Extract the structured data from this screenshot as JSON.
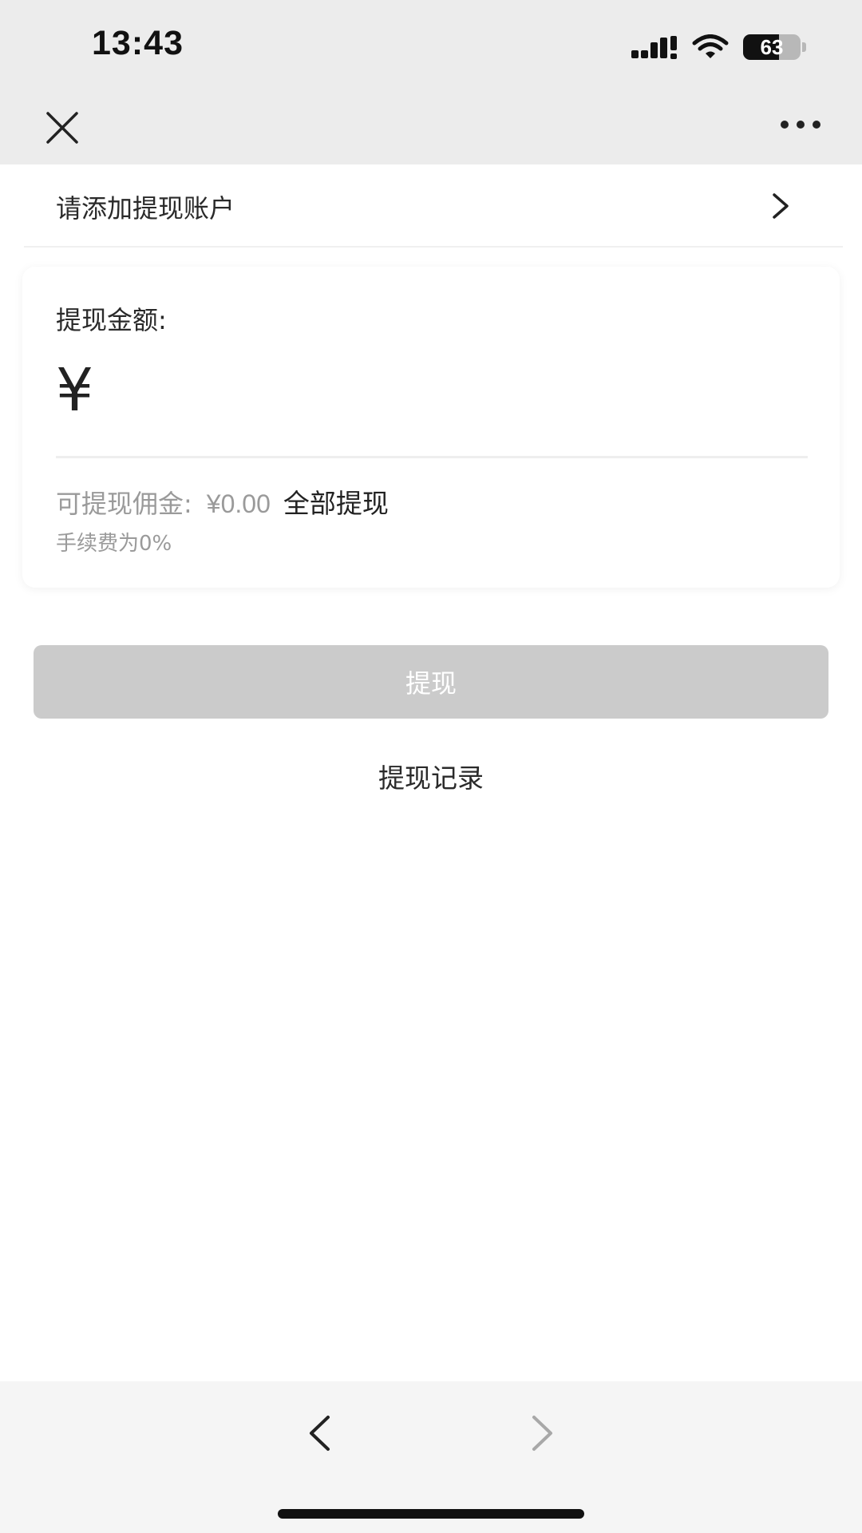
{
  "status_bar": {
    "time": "13:43",
    "battery_percent": "63",
    "battery_level": 0.63,
    "icons": [
      "signal-icon",
      "wifi-icon",
      "battery-icon"
    ]
  },
  "nav": {
    "close_icon": "close-icon",
    "more_icon": "more-horizontal-icon"
  },
  "account": {
    "label": "请添加提现账户",
    "chevron_icon": "chevron-right-icon"
  },
  "withdraw_card": {
    "amount_title": "提现金额:",
    "currency_symbol": "¥",
    "amount_value": "",
    "available_label": "可提现佣金:",
    "available_value": "¥0.00",
    "withdraw_all_label": "全部提现",
    "fee_note": "手续费为0%"
  },
  "actions": {
    "withdraw_button_label": "提现",
    "withdraw_button_color": "#cbcbcb",
    "history_link_label": "提现记录"
  },
  "bottom_toolbar": {
    "back_icon": "chevron-left-icon",
    "forward_icon": "chevron-right-icon",
    "forward_enabled": false
  }
}
